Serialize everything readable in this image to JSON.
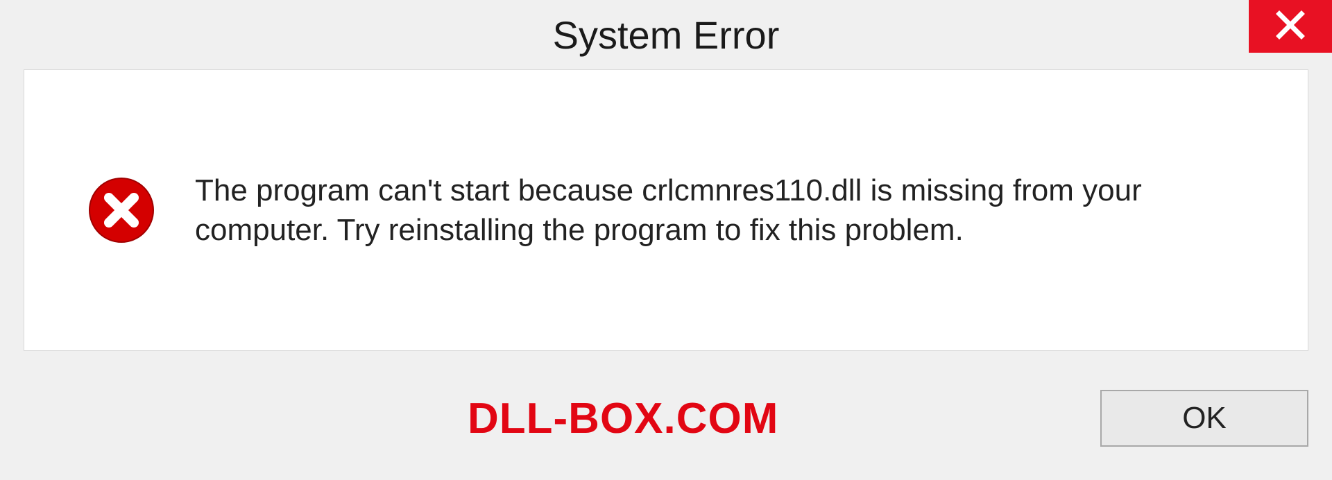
{
  "title": "System Error",
  "message": "The program can't start because crlcmnres110.dll is missing from your computer. Try reinstalling the program to fix this problem.",
  "ok_label": "OK",
  "watermark": "DLL-BOX.COM",
  "colors": {
    "close_bg": "#e81123",
    "error_icon": "#d40000",
    "watermark": "#e20613"
  }
}
